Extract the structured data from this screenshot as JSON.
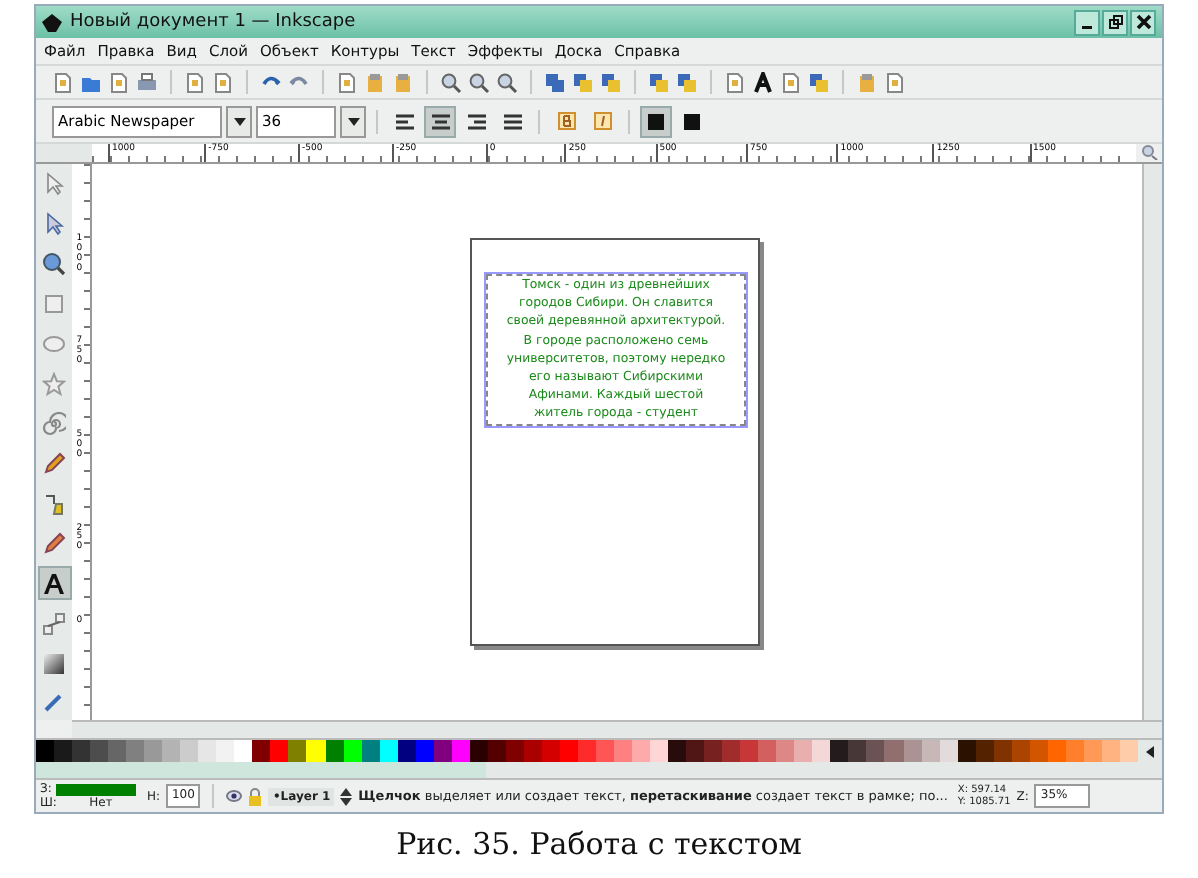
{
  "window": {
    "title": "Новый документ 1 — Inkscape"
  },
  "menu": [
    "Файл",
    "Правка",
    "Вид",
    "Слой",
    "Объект",
    "Контуры",
    "Текст",
    "Эффекты",
    "Доска",
    "Справка"
  ],
  "text_toolbar": {
    "font_family": "Arabic Newspaper",
    "font_size": "36",
    "align_buttons": [
      {
        "selected": false
      },
      {
        "selected": true
      },
      {
        "selected": false
      },
      {
        "selected": false
      }
    ],
    "mode_buttons": [
      {
        "selected": true
      },
      {
        "selected": false
      }
    ]
  },
  "h_ruler": [
    "1000",
    "-750",
    "-500",
    "-250",
    "0",
    "250",
    "500",
    "750",
    "1000",
    "1250",
    "1500"
  ],
  "v_ruler": [
    "1000",
    "750",
    "500",
    "250",
    "0"
  ],
  "tools": [
    {
      "selected": false
    },
    {
      "selected": false
    },
    {
      "selected": false
    },
    {
      "selected": false
    },
    {
      "selected": false
    },
    {
      "selected": false
    },
    {
      "selected": false
    },
    {
      "selected": false
    },
    {
      "selected": false
    },
    {
      "selected": false
    },
    {
      "selected": true
    },
    {
      "selected": false
    },
    {
      "selected": false
    },
    {
      "selected": false
    }
  ],
  "canvas": {
    "text": "Томск - один из древнейших\nгородов Сибири. Он славится\nсвоей деревянной архитектурой.\nВ городе расположено семь\nуниверситетов, поэтому нередко\nего называют Сибирскими\nАфинами. Каждый шестой\nжитель города - студент"
  },
  "palette": [
    {
      "color": "#000000"
    },
    {
      "color": "#1a1a1a"
    },
    {
      "color": "#333333"
    },
    {
      "color": "#4d4d4d"
    },
    {
      "color": "#666666"
    },
    {
      "color": "#808080"
    },
    {
      "color": "#999999"
    },
    {
      "color": "#b3b3b3"
    },
    {
      "color": "#cccccc"
    },
    {
      "color": "#e6e6e6"
    },
    {
      "color": "#f2f2f2"
    },
    {
      "color": "#ffffff"
    },
    {
      "color": "#800000"
    },
    {
      "color": "#ff0000"
    },
    {
      "color": "#808000"
    },
    {
      "color": "#ffff00"
    },
    {
      "color": "#008000"
    },
    {
      "color": "#00ff00"
    },
    {
      "color": "#008080"
    },
    {
      "color": "#00ffff"
    },
    {
      "color": "#000080"
    },
    {
      "color": "#0000ff"
    },
    {
      "color": "#800080"
    },
    {
      "color": "#ff00ff"
    },
    {
      "color": "#2b0000"
    },
    {
      "color": "#550000"
    },
    {
      "color": "#800000"
    },
    {
      "color": "#aa0000"
    },
    {
      "color": "#d40000"
    },
    {
      "color": "#ff0000"
    },
    {
      "color": "#ff2a2a"
    },
    {
      "color": "#ff5555"
    },
    {
      "color": "#ff8080"
    },
    {
      "color": "#ffaaaa"
    },
    {
      "color": "#ffd5d5"
    },
    {
      "color": "#280b0b"
    },
    {
      "color": "#501616"
    },
    {
      "color": "#782121"
    },
    {
      "color": "#a02c2c"
    },
    {
      "color": "#c83737"
    },
    {
      "color": "#d35f5f"
    },
    {
      "color": "#de8787"
    },
    {
      "color": "#e9afaf"
    },
    {
      "color": "#f4d7d7"
    },
    {
      "color": "#241c1c"
    },
    {
      "color": "#483737"
    },
    {
      "color": "#6c5353"
    },
    {
      "color": "#916f6f"
    },
    {
      "color": "#ac9393"
    },
    {
      "color": "#c8b7b7"
    },
    {
      "color": "#e3dbdb"
    },
    {
      "color": "#2b1100"
    },
    {
      "color": "#552200"
    },
    {
      "color": "#803300"
    },
    {
      "color": "#aa4400"
    },
    {
      "color": "#d45500"
    },
    {
      "color": "#ff6600"
    },
    {
      "color": "#ff7f2a"
    },
    {
      "color": "#ff9955"
    },
    {
      "color": "#ffb380"
    },
    {
      "color": "#ffccaa"
    }
  ],
  "status_bar": {
    "fill_label": "З:",
    "fill": {
      "color": "#008000"
    },
    "stroke_label": "Ш:",
    "stroke_value": "Нет",
    "opacity_label": "Н:",
    "opacity": "100",
    "layer": "•Layer 1",
    "message": "**Щелчок** выделяет или создает текст, **перетаскивание** создает текст в рамке; по...",
    "x": "X: 597.14",
    "y": "Y: 1085.71",
    "zoom_label": "Z:",
    "zoom": "35%"
  },
  "caption": "Рис. 35. Работа с текстом"
}
